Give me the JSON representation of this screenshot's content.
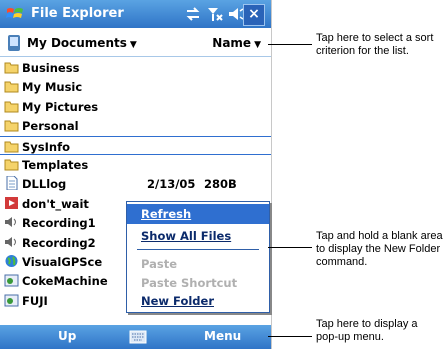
{
  "app": {
    "title": "File Explorer",
    "close_label": "×"
  },
  "location": {
    "folder": "My Documents",
    "sort_by": "Name"
  },
  "files": [
    {
      "name": "Business",
      "date": "",
      "size": "",
      "icon": "folder-icon"
    },
    {
      "name": "My Music",
      "date": "",
      "size": "",
      "icon": "folder-icon"
    },
    {
      "name": "My Pictures",
      "date": "",
      "size": "",
      "icon": "folder-icon"
    },
    {
      "name": "Personal",
      "date": "",
      "size": "",
      "icon": "folder-icon"
    },
    {
      "name": "SysInfo",
      "date": "",
      "size": "",
      "icon": "folder-icon"
    },
    {
      "name": "Templates",
      "date": "",
      "size": "",
      "icon": "folder-icon"
    },
    {
      "name": "DLLlog",
      "date": "2/13/05",
      "size": "280B",
      "icon": "document-icon"
    },
    {
      "name": "don't_wait",
      "date": "",
      "size": "",
      "icon": "media-icon"
    },
    {
      "name": "Recording1",
      "date": "",
      "size": "",
      "icon": "recording-icon"
    },
    {
      "name": "Recording2",
      "date": "",
      "size": "",
      "icon": "recording-icon"
    },
    {
      "name": "VisualGPSce",
      "date": "",
      "size": "",
      "icon": "program-icon"
    },
    {
      "name": "CokeMachine",
      "date": "",
      "size": "",
      "icon": "program-icon"
    },
    {
      "name": "FUJI",
      "date": "",
      "size": "",
      "icon": "program-icon"
    }
  ],
  "context_menu": {
    "refresh": "Refresh",
    "show_all_files": "Show All Files",
    "paste": "Paste",
    "paste_shortcut": "Paste Shortcut",
    "new_folder": "New Folder"
  },
  "bottom_bar": {
    "up": "Up",
    "menu": "Menu"
  },
  "callouts": {
    "sort": "Tap here to select a sort criterion for the list.",
    "blank": "Tap and hold a blank area to display the New Folder command.",
    "menu": "Tap here to display a pop-up menu."
  },
  "colors": {
    "titlebar": "#3a86d6",
    "selection": "#2f6fd0"
  }
}
